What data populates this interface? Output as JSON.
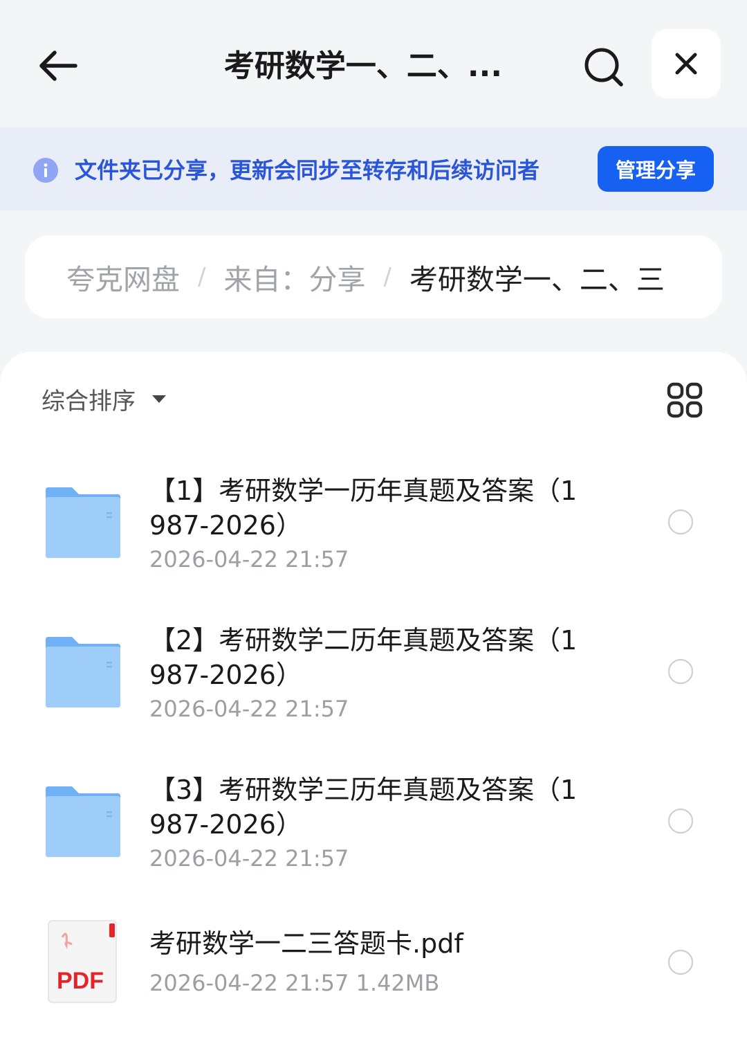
{
  "header": {
    "title": "考研数学一、二、...",
    "back_icon": "arrow-left-icon",
    "search_icon": "search-icon",
    "close_icon": "close-icon"
  },
  "banner": {
    "text": "文件夹已分享，更新会同步至转存和后续访问者",
    "button_label": "管理分享",
    "accent": "#1660f2"
  },
  "breadcrumb": {
    "items": [
      "夸克网盘",
      "来自：分享",
      "考研数学一、二、三"
    ],
    "separator": "/"
  },
  "toolbar": {
    "sort_label": "综合排序",
    "view_icon": "grid-view-icon"
  },
  "files": [
    {
      "name": "【1】考研数学一历年真题及答案（1987-2026）",
      "meta": "2026-04-22 21:57",
      "type": "folder"
    },
    {
      "name": "【2】考研数学二历年真题及答案（1987-2026）",
      "meta": "2026-04-22 21:57",
      "type": "folder"
    },
    {
      "name": "【3】考研数学三历年真题及答案（1987-2026）",
      "meta": "2026-04-22 21:57",
      "type": "folder"
    },
    {
      "name": "考研数学一二三答题卡.pdf",
      "meta": "2026-04-22 21:57  1.42MB",
      "type": "pdf",
      "badge": "PDF"
    }
  ]
}
